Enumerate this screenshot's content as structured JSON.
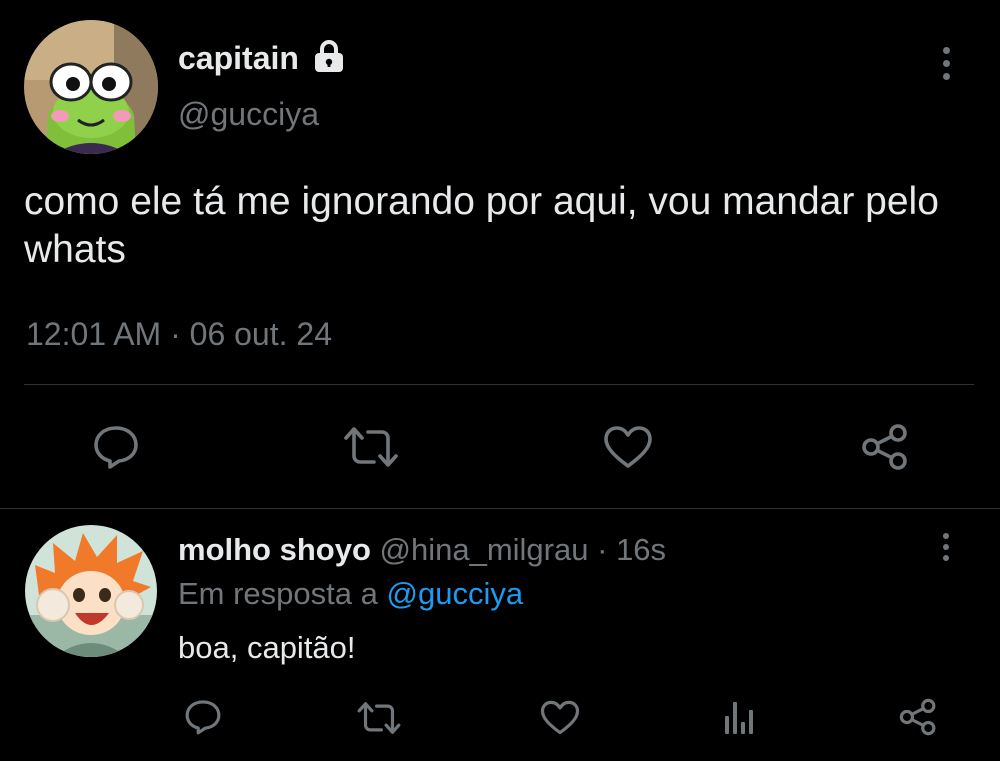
{
  "main_tweet": {
    "display_name": "capitain",
    "protected_icon": "lock-icon",
    "handle": "@gucciya",
    "text": "como ele tá me ignorando por aqui, vou mandar pelo whats",
    "time": "12:01 AM",
    "separator": "·",
    "date": "06 out. 24",
    "actions": [
      "reply-icon",
      "retweet-icon",
      "like-icon",
      "share-icon"
    ]
  },
  "reply": {
    "display_name": "molho shoyo",
    "handle": "@hina_milgrau",
    "separator": "·",
    "age": "16s",
    "reply_prefix": "Em resposta a",
    "reply_to": "@gucciya",
    "text": "boa, capitão!",
    "actions": [
      "reply-icon",
      "retweet-icon",
      "like-icon",
      "analytics-icon",
      "share-icon"
    ]
  },
  "colors": {
    "background": "#000000",
    "text": "#e7e9ea",
    "muted": "#71767b",
    "link": "#1d9bf0",
    "divider": "#2f3336"
  }
}
